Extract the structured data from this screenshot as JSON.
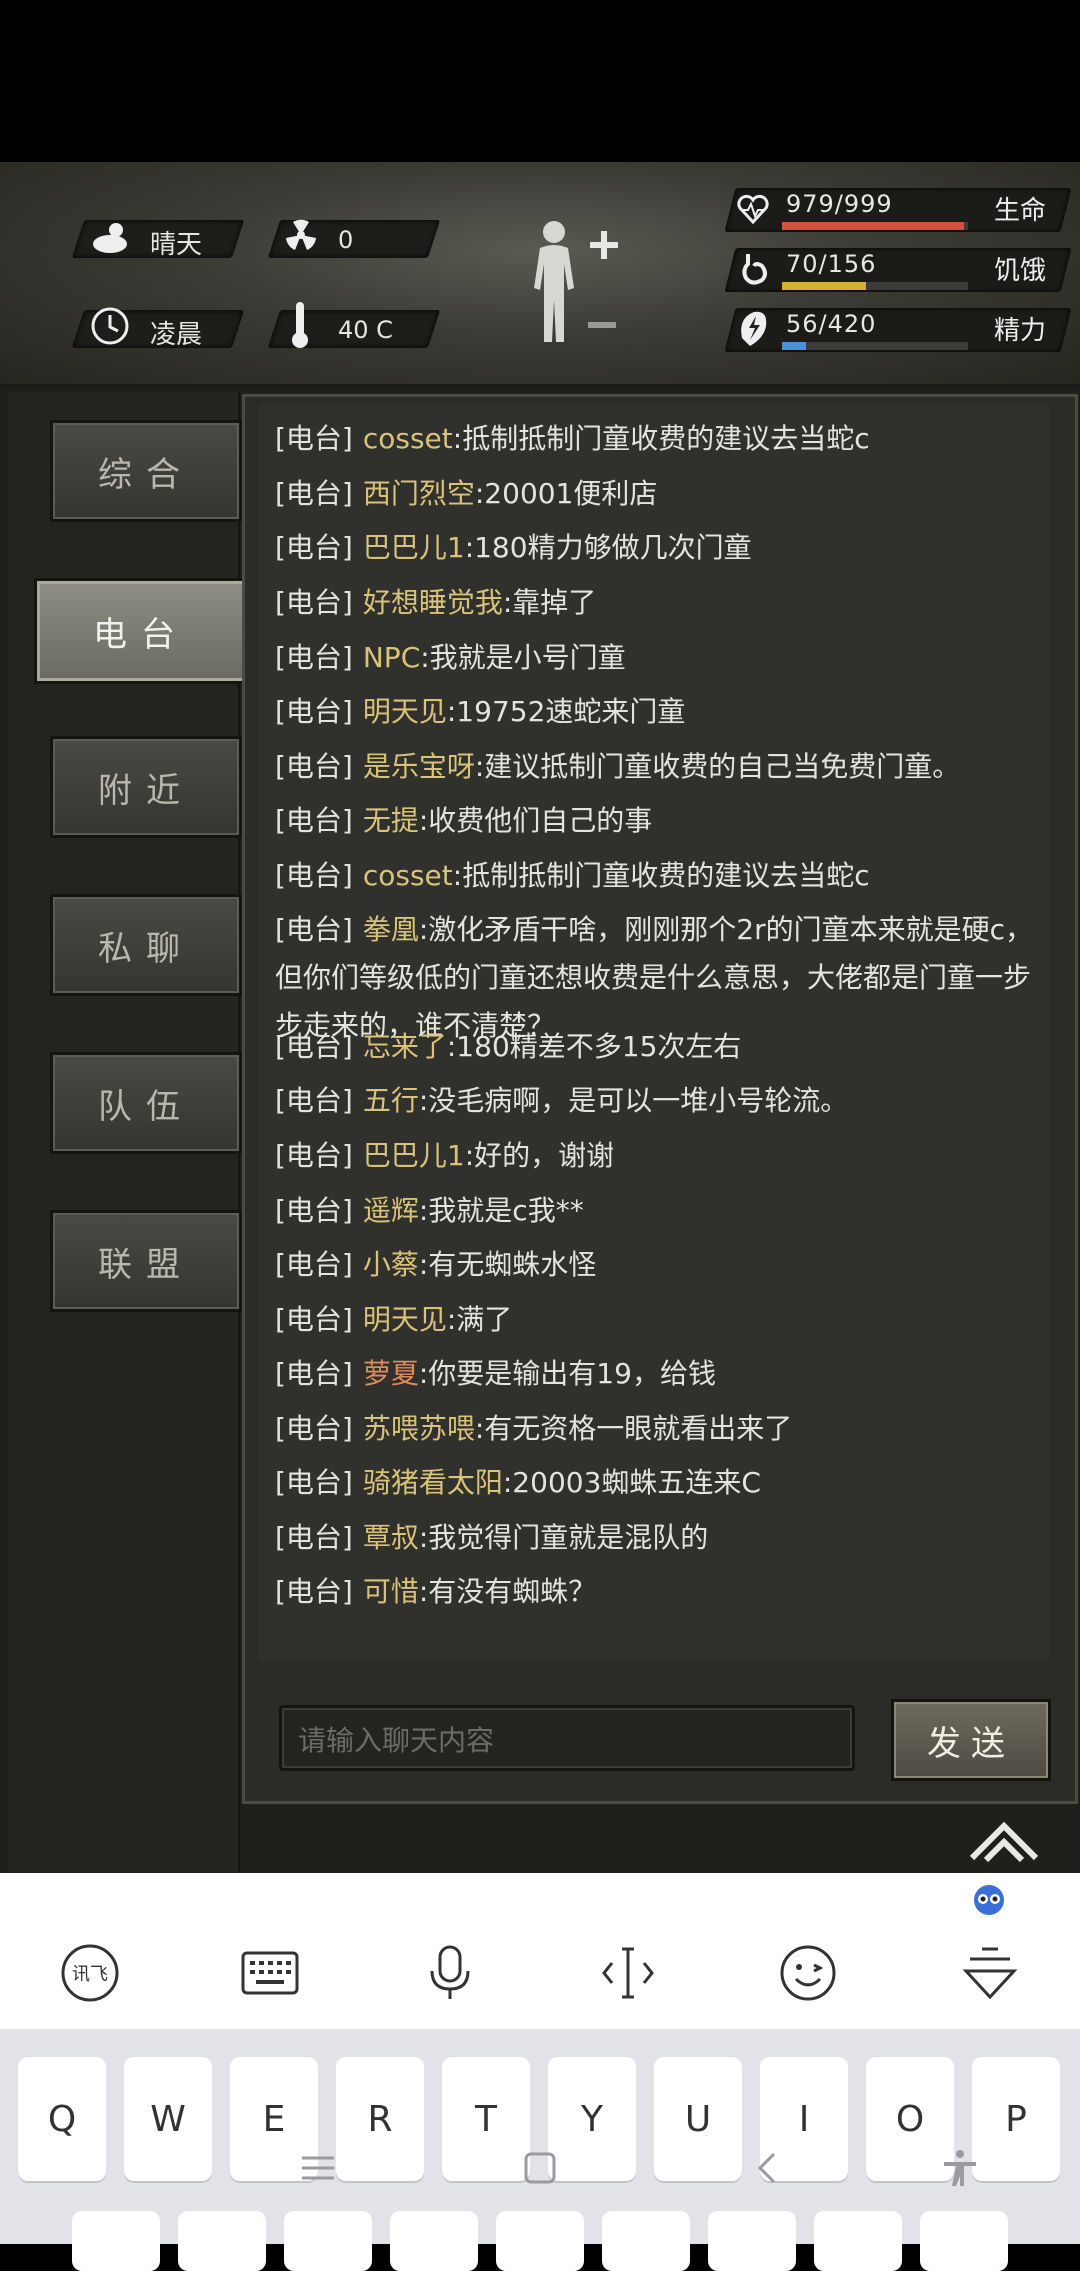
{
  "status": {
    "weather": "晴天",
    "radiation": "0",
    "time_of_day": "凌晨",
    "temperature": "40 C",
    "stats": [
      {
        "label": "生命",
        "value": "979/999",
        "fraction": 0.98,
        "color": "#d2503f",
        "icon": "heart-icon"
      },
      {
        "label": "饥饿",
        "value": "70/156",
        "fraction": 0.45,
        "color": "#d9ac33",
        "icon": "stomach-icon"
      },
      {
        "label": "精力",
        "value": "56/420",
        "fraction": 0.13,
        "color": "#4f8fd8",
        "icon": "energy-icon"
      }
    ]
  },
  "tabs": [
    {
      "label": "综合",
      "active": false
    },
    {
      "label": "电台",
      "active": true
    },
    {
      "label": "附近",
      "active": false
    },
    {
      "label": "私聊",
      "active": false
    },
    {
      "label": "队伍",
      "active": false
    },
    {
      "label": "联盟",
      "active": false
    }
  ],
  "messages": [
    {
      "channel": "[电台]",
      "name": "cosset",
      "text": ":抵制抵制门童收费的建议去当蛇c"
    },
    {
      "channel": "[电台]",
      "name": "西门烈空",
      "text": ":20001便利店"
    },
    {
      "channel": "[电台]",
      "name": "巴巴儿1",
      "text": ":180精力够做几次门童"
    },
    {
      "channel": "[电台]",
      "name": "好想睡觉我",
      "text": ":靠掉了"
    },
    {
      "channel": "[电台]",
      "name": "NPC",
      "text": ":我就是小号门童"
    },
    {
      "channel": "[电台]",
      "name": "明天见",
      "text": ":19752速蛇来门童"
    },
    {
      "channel": "[电台]",
      "name": "是乐宝呀",
      "text": ":建议抵制门童收费的自己当免费门童。"
    },
    {
      "channel": "[电台]",
      "name": "无提",
      "text": ":收费他们自己的事"
    },
    {
      "channel": "[电台]",
      "name": "cosset",
      "text": ":抵制抵制门童收费的建议去当蛇c"
    },
    {
      "channel": "[电台]",
      "name": "拳凰",
      "text": ":激化矛盾干啥，刚刚那个2r的门童本来就是硬c，但你们等级低的门童还想收费是什么意思，大佬都是门童一步步走来的，谁不清楚？"
    },
    {
      "channel": "[电台]",
      "name": "忘来了",
      "text": ":180精差不多15次左右"
    },
    {
      "channel": "[电台]",
      "name": "五行",
      "text": ":没毛病啊，是可以一堆小号轮流。"
    },
    {
      "channel": "[电台]",
      "name": "巴巴儿1",
      "text": ":好的，谢谢"
    },
    {
      "channel": "[电台]",
      "name": "遥辉",
      "text": ":我就是c我**"
    },
    {
      "channel": "[电台]",
      "name": "小蔡",
      "text": ":有无蜘蛛水怪"
    },
    {
      "channel": "[电台]",
      "name": "明天见",
      "text": ":满了"
    },
    {
      "channel": "[电台]",
      "name": "萝夏",
      "text": ":你要是输出有19，给钱",
      "red": true
    },
    {
      "channel": "[电台]",
      "name": "苏喂苏喂",
      "text": ":有无资格一眼就看出来了"
    },
    {
      "channel": "[电台]",
      "name": "骑猪看太阳",
      "text": ":20003蜘蛛五连来C"
    },
    {
      "channel": "[电台]",
      "name": "覃叔",
      "text": ":我觉得门童就是混队的"
    },
    {
      "channel": "[电台]",
      "name": "可惜",
      "text": ":有没有蜘蛛？"
    }
  ],
  "input": {
    "placeholder": "请输入聊天内容",
    "value": ""
  },
  "send_label": "发送",
  "keyboard": {
    "row1": [
      "Q",
      "W",
      "E",
      "R",
      "T",
      "Y",
      "U",
      "I",
      "O",
      "P"
    ],
    "toolbar_icons": [
      "ifly-logo-icon",
      "keyboard-icon",
      "microphone-icon",
      "cursor-move-icon",
      "emoji-icon",
      "hide-keyboard-icon"
    ]
  }
}
